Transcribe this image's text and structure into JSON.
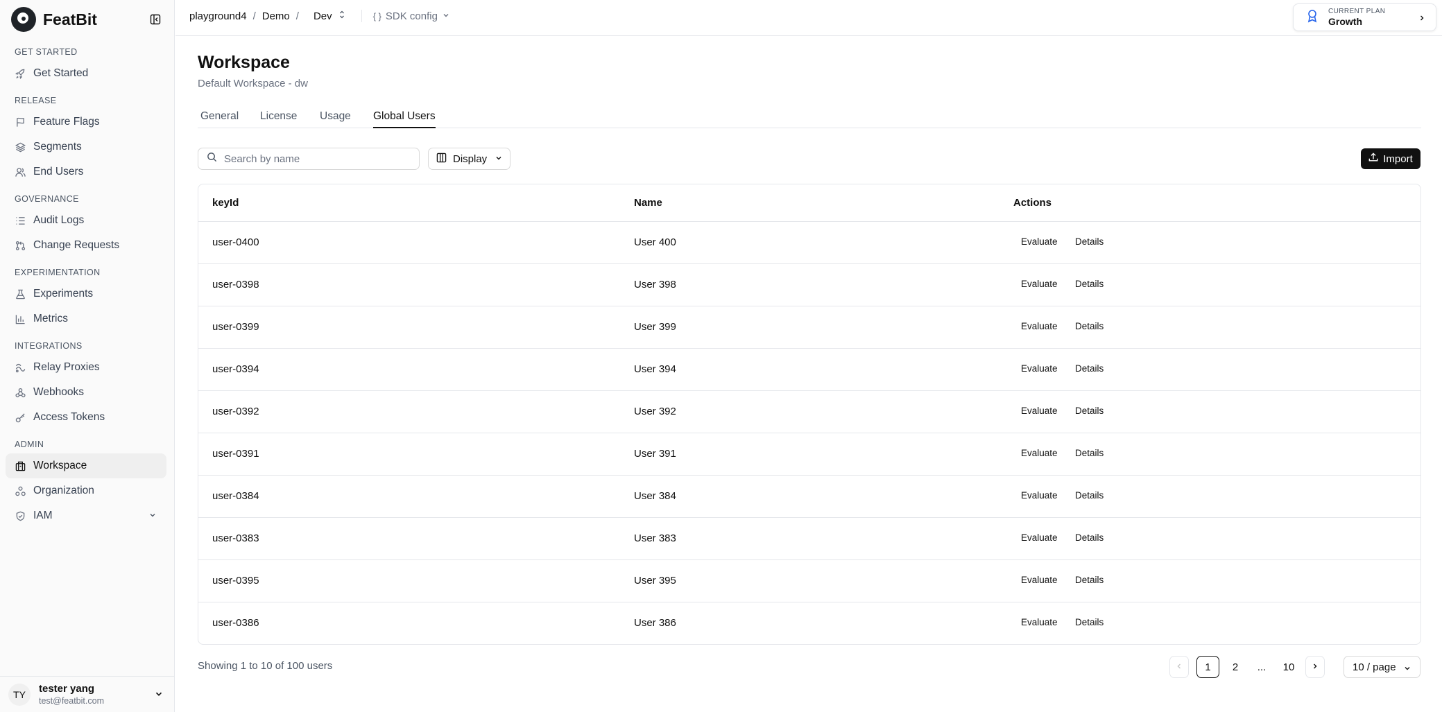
{
  "brand": {
    "name": "FeatBit"
  },
  "sidebar": {
    "sections": [
      {
        "title": "GET STARTED",
        "items": [
          {
            "label": "Get Started",
            "icon": "rocket-icon"
          }
        ]
      },
      {
        "title": "RELEASE",
        "items": [
          {
            "label": "Feature Flags",
            "icon": "flag-icon"
          },
          {
            "label": "Segments",
            "icon": "layers-icon"
          },
          {
            "label": "End Users",
            "icon": "users-icon"
          }
        ]
      },
      {
        "title": "GOVERNANCE",
        "items": [
          {
            "label": "Audit Logs",
            "icon": "list-icon"
          },
          {
            "label": "Change Requests",
            "icon": "git-pull-request-icon"
          }
        ]
      },
      {
        "title": "EXPERIMENTATION",
        "items": [
          {
            "label": "Experiments",
            "icon": "flask-icon"
          },
          {
            "label": "Metrics",
            "icon": "bar-chart-icon"
          }
        ]
      },
      {
        "title": "INTEGRATIONS",
        "items": [
          {
            "label": "Relay Proxies",
            "icon": "relay-icon"
          },
          {
            "label": "Webhooks",
            "icon": "webhook-icon"
          },
          {
            "label": "Access Tokens",
            "icon": "key-icon"
          }
        ]
      },
      {
        "title": "ADMIN",
        "items": [
          {
            "label": "Workspace",
            "icon": "building-icon",
            "active": true
          },
          {
            "label": "Organization",
            "icon": "organization-icon"
          },
          {
            "label": "IAM",
            "icon": "shield-icon",
            "expandable": true
          }
        ]
      }
    ],
    "user": {
      "initials": "TY",
      "name": "tester yang",
      "email": "test@featbit.com"
    }
  },
  "topbar": {
    "crumbs": [
      "playground4",
      "Demo"
    ],
    "env": "Dev",
    "sdk_config": "SDK config",
    "plan": {
      "label": "CURRENT PLAN",
      "value": "Growth"
    }
  },
  "page": {
    "title": "Workspace",
    "subtitle": "Default Workspace - dw",
    "tabs": [
      {
        "label": "General"
      },
      {
        "label": "License"
      },
      {
        "label": "Usage"
      },
      {
        "label": "Global Users",
        "active": true
      }
    ]
  },
  "toolbar": {
    "search_placeholder": "Search by name",
    "display_label": "Display",
    "import_label": "Import"
  },
  "table": {
    "headers": [
      "keyId",
      "Name",
      "Actions"
    ],
    "action_labels": [
      "Evaluate",
      "Details"
    ],
    "rows": [
      {
        "keyId": "user-0400",
        "name": "User 400"
      },
      {
        "keyId": "user-0398",
        "name": "User 398"
      },
      {
        "keyId": "user-0399",
        "name": "User 399"
      },
      {
        "keyId": "user-0394",
        "name": "User 394"
      },
      {
        "keyId": "user-0392",
        "name": "User 392"
      },
      {
        "keyId": "user-0391",
        "name": "User 391"
      },
      {
        "keyId": "user-0384",
        "name": "User 384"
      },
      {
        "keyId": "user-0383",
        "name": "User 383"
      },
      {
        "keyId": "user-0395",
        "name": "User 395"
      },
      {
        "keyId": "user-0386",
        "name": "User 386"
      }
    ]
  },
  "pagination": {
    "showing": "Showing 1 to 10 of 100 users",
    "pages": [
      "1",
      "2",
      "...",
      "10"
    ],
    "current": "1",
    "page_size": "10 / page"
  },
  "colors": {
    "primary": "#111111",
    "border": "#e5e7eb",
    "muted": "#6b7280"
  }
}
